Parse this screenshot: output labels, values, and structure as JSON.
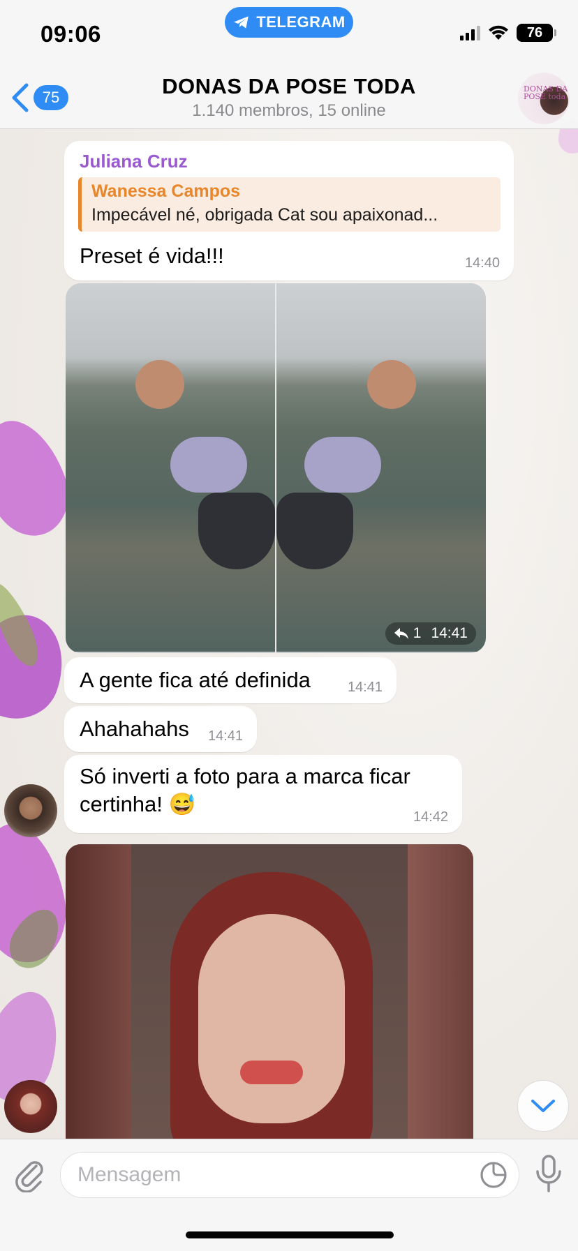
{
  "status_bar": {
    "time": "09:06",
    "pill_label": "TELEGRAM",
    "battery": "76"
  },
  "header": {
    "back_badge": "75",
    "title": "DONAS DA POSE TODA",
    "subtitle": "1.140 membros, 15 online",
    "avatar_text": "DONAS DA POSE toda"
  },
  "messages": {
    "m1": {
      "sender": "Juliana Cruz",
      "reply_name": "Wanessa Campos",
      "reply_text": "Impecável né, obrigada Cat sou apaixonad...",
      "text": "Preset é vida!!!",
      "time": "14:40"
    },
    "m2": {
      "reply_count": "1",
      "time": "14:41"
    },
    "m3": {
      "text": "A gente fica até definida",
      "time": "14:41"
    },
    "m4": {
      "text": "Ahahahahs",
      "time": "14:41"
    },
    "m5": {
      "text_line1": "Só inverti a foto para a marca ficar",
      "text_line2": "certinha! 😅",
      "time": "14:42"
    }
  },
  "composer": {
    "placeholder": "Mensagem"
  },
  "colors": {
    "accent": "#2f8cf5",
    "sender": "#9b59d0",
    "reply_accent": "#e8862a",
    "reply_bg": "#fbece1"
  },
  "icons": [
    "telegram-icon",
    "signal-icon",
    "wifi-icon",
    "battery-icon",
    "back-chevron-icon",
    "reply-arrow-icon",
    "chevron-down-icon",
    "paperclip-icon",
    "sticker-icon",
    "microphone-icon"
  ]
}
